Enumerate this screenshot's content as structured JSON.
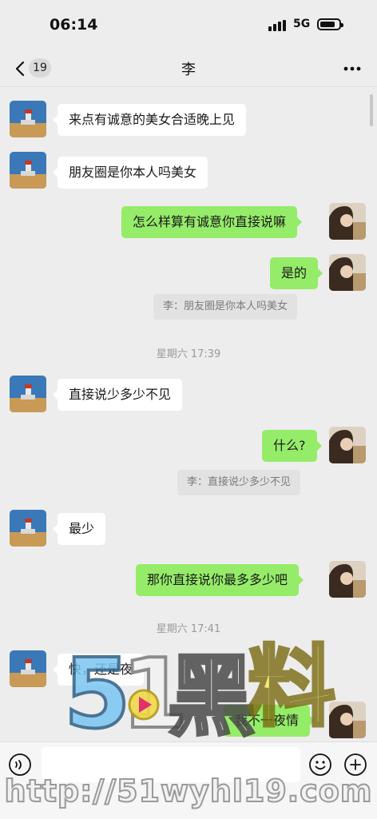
{
  "status": {
    "time": "06:14",
    "network": "5G"
  },
  "nav": {
    "unread_count": "19",
    "title": "李"
  },
  "messages": {
    "m1": "来点有诚意的美女合适晚上见",
    "m2": "朋友圈是你本人吗美女",
    "m3": "怎么样算有诚意你直接说嘛",
    "m4": "是的",
    "q1": "李：朋友圈是你本人吗美女",
    "t1": "星期六 17:39",
    "m5": "直接说少多少不见",
    "m6": "什么?",
    "q2": "李：直接说少多少不见",
    "m7": "最少",
    "m8": "那你直接说你最多多少吧",
    "t2": "星期六 17:41",
    "m9": "快，还是夜",
    "m10": "我不一夜情"
  },
  "watermark": {
    "logo": "51黑料",
    "url": "http://51wyhl19.com"
  },
  "icons": {
    "back": "chevron-left-icon",
    "more": "more-dots-icon",
    "voice": "voice-icon",
    "emoji": "emoji-icon",
    "plus": "plus-icon"
  },
  "colors": {
    "outgoing_bubble": "#95ec69",
    "incoming_bubble": "#ffffff",
    "background": "#ededed"
  }
}
